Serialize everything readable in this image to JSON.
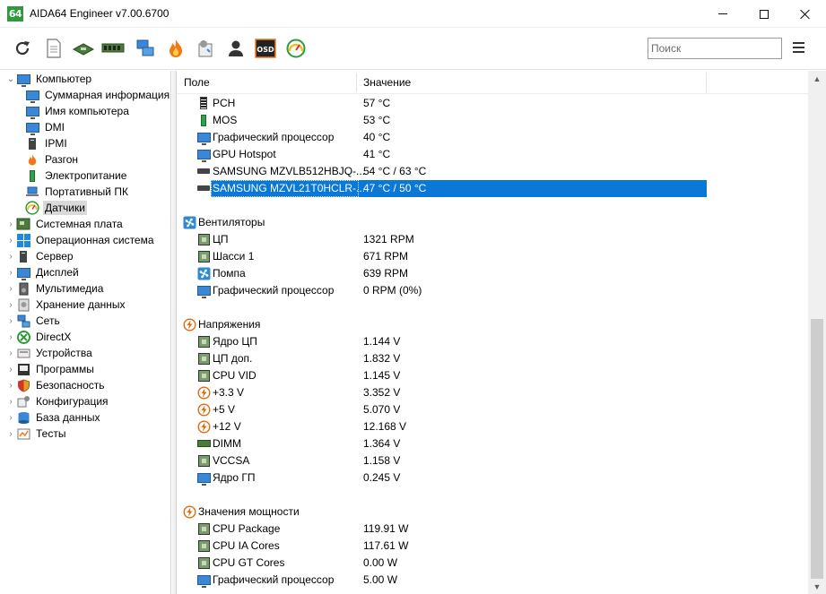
{
  "window": {
    "icon_text": "64",
    "title": "AIDA64 Engineer v7.00.6700"
  },
  "toolbar": {
    "buttons": [
      {
        "name": "refresh-icon",
        "color": "#333333"
      },
      {
        "name": "report-icon",
        "color": "#888888"
      },
      {
        "name": "motherboard-icon",
        "color": "#4c7a3a"
      },
      {
        "name": "memory-icon",
        "color": "#4c7a3a"
      },
      {
        "name": "network-icon",
        "color": "#3a87d6"
      },
      {
        "name": "flame-icon",
        "color": "#f07a1a"
      },
      {
        "name": "tools-icon",
        "color": "#777777"
      },
      {
        "name": "user-icon",
        "color": "#333333"
      },
      {
        "name": "osd-icon",
        "color": "#f07a1a"
      },
      {
        "name": "gauge-icon",
        "color": "#2e9a3a"
      }
    ],
    "osd_label": "OSD",
    "search_placeholder": "Поиск"
  },
  "tree": {
    "items": [
      {
        "label": "Компьютер",
        "level": 0,
        "expander": "v",
        "icon": "computer-icon"
      },
      {
        "label": "Суммарная информация",
        "level": 1,
        "expander": "",
        "icon": "monitor-icon"
      },
      {
        "label": "Имя компьютера",
        "level": 1,
        "expander": "",
        "icon": "monitor-icon"
      },
      {
        "label": "DMI",
        "level": 1,
        "expander": "",
        "icon": "monitor-icon"
      },
      {
        "label": "IPMI",
        "level": 1,
        "expander": "",
        "icon": "server-icon"
      },
      {
        "label": "Разгон",
        "level": 1,
        "expander": "",
        "icon": "flame-icon"
      },
      {
        "label": "Электропитание",
        "level": 1,
        "expander": "",
        "icon": "battery-icon"
      },
      {
        "label": "Портативный ПК",
        "level": 1,
        "expander": "",
        "icon": "laptop-icon"
      },
      {
        "label": "Датчики",
        "level": 1,
        "expander": "",
        "icon": "gauge-icon",
        "selected": true
      },
      {
        "label": "Системная плата",
        "level": 0,
        "expander": ">",
        "icon": "motherboard-icon"
      },
      {
        "label": "Операционная система",
        "level": 0,
        "expander": ">",
        "icon": "windows-icon"
      },
      {
        "label": "Сервер",
        "level": 0,
        "expander": ">",
        "icon": "server-icon"
      },
      {
        "label": "Дисплей",
        "level": 0,
        "expander": ">",
        "icon": "monitor-icon"
      },
      {
        "label": "Мультимедиа",
        "level": 0,
        "expander": ">",
        "icon": "speaker-icon"
      },
      {
        "label": "Хранение данных",
        "level": 0,
        "expander": ">",
        "icon": "storage-icon"
      },
      {
        "label": "Сеть",
        "level": 0,
        "expander": ">",
        "icon": "network-icon"
      },
      {
        "label": "DirectX",
        "level": 0,
        "expander": ">",
        "icon": "directx-icon"
      },
      {
        "label": "Устройства",
        "level": 0,
        "expander": ">",
        "icon": "devices-icon"
      },
      {
        "label": "Программы",
        "level": 0,
        "expander": ">",
        "icon": "programs-icon"
      },
      {
        "label": "Безопасность",
        "level": 0,
        "expander": ">",
        "icon": "shield-icon"
      },
      {
        "label": "Конфигурация",
        "level": 0,
        "expander": ">",
        "icon": "config-icon"
      },
      {
        "label": "База данных",
        "level": 0,
        "expander": ">",
        "icon": "database-icon"
      },
      {
        "label": "Тесты",
        "level": 0,
        "expander": ">",
        "icon": "tests-icon"
      }
    ]
  },
  "list": {
    "col_field": "Поле",
    "col_value": "Значение",
    "rows": [
      {
        "type": "item",
        "icon": "thermometer-icon",
        "field": "PCH",
        "value": "57 °C"
      },
      {
        "type": "item",
        "icon": "battery-icon",
        "field": "MOS",
        "value": "53 °C"
      },
      {
        "type": "item",
        "icon": "monitor-icon",
        "field": "Графический процессор",
        "value": "40 °C"
      },
      {
        "type": "item",
        "icon": "monitor-icon",
        "field": "GPU Hotspot",
        "value": "41 °C"
      },
      {
        "type": "item",
        "icon": "ssd-icon",
        "field": "SAMSUNG MZVLB512HBJQ-...",
        "value": "54 °C / 63 °C"
      },
      {
        "type": "item",
        "icon": "ssd-icon",
        "field": "SAMSUNG MZVL21T0HCLR-...",
        "value": "47 °C / 50 °C",
        "selected": true
      },
      {
        "type": "spacer"
      },
      {
        "type": "group",
        "icon": "fan-icon",
        "field": "Вентиляторы"
      },
      {
        "type": "item",
        "icon": "chip-icon",
        "field": "ЦП",
        "value": "1321 RPM"
      },
      {
        "type": "item",
        "icon": "chip-icon",
        "field": "Шасси 1",
        "value": "671 RPM"
      },
      {
        "type": "item",
        "icon": "fan-icon",
        "field": "Помпа",
        "value": "639 RPM"
      },
      {
        "type": "item",
        "icon": "monitor-icon",
        "field": "Графический процессор",
        "value": "0 RPM  (0%)"
      },
      {
        "type": "spacer"
      },
      {
        "type": "group",
        "icon": "voltage-icon",
        "field": "Напряжения"
      },
      {
        "type": "item",
        "icon": "chip-icon",
        "field": "Ядро ЦП",
        "value": "1.144 V"
      },
      {
        "type": "item",
        "icon": "chip-icon",
        "field": "ЦП доп.",
        "value": "1.832 V"
      },
      {
        "type": "item",
        "icon": "chip-icon",
        "field": "CPU VID",
        "value": "1.145 V"
      },
      {
        "type": "item",
        "icon": "voltage-icon",
        "field": "+3.3 V",
        "value": "3.352 V"
      },
      {
        "type": "item",
        "icon": "voltage-icon",
        "field": "+5 V",
        "value": "5.070 V"
      },
      {
        "type": "item",
        "icon": "voltage-icon",
        "field": "+12 V",
        "value": "12.168 V"
      },
      {
        "type": "item",
        "icon": "dimm-icon",
        "field": "DIMM",
        "value": "1.364 V"
      },
      {
        "type": "item",
        "icon": "chip-icon",
        "field": "VCCSA",
        "value": "1.158 V"
      },
      {
        "type": "item",
        "icon": "monitor-icon",
        "field": "Ядро ГП",
        "value": "0.245 V"
      },
      {
        "type": "spacer"
      },
      {
        "type": "group",
        "icon": "voltage-icon",
        "field": "Значения мощности"
      },
      {
        "type": "item",
        "icon": "chip-icon",
        "field": "CPU Package",
        "value": "119.91 W"
      },
      {
        "type": "item",
        "icon": "chip-icon",
        "field": "CPU IA Cores",
        "value": "117.61 W"
      },
      {
        "type": "item",
        "icon": "chip-icon",
        "field": "CPU GT Cores",
        "value": "0.00 W"
      },
      {
        "type": "item",
        "icon": "monitor-icon",
        "field": "Графический процессор",
        "value": "5.00 W"
      }
    ]
  },
  "colors": {
    "selection": "#0a78d7",
    "tree_selection": "#d9d9d9",
    "app_icon": "#2e9a3a"
  }
}
